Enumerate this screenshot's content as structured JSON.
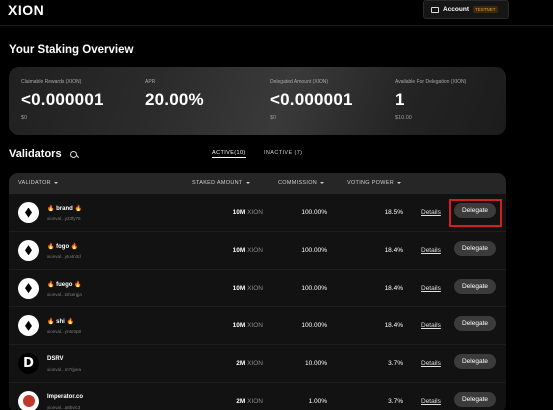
{
  "header": {
    "logo": "XION",
    "account_label": "Account",
    "network_badge": "TESTNET"
  },
  "overview": {
    "title": "Your Staking Overview",
    "stats": [
      {
        "label": "Claimable Rewards (XION)",
        "value": "<0.000001",
        "sub": "$0"
      },
      {
        "label": "APR",
        "value": "20.00%",
        "sub": ""
      },
      {
        "label": "Delegated Amount (XION)",
        "value": "<0.000001",
        "sub": "$0"
      },
      {
        "label": "Available For Delegation (XION)",
        "value": "1",
        "sub": "$10.00"
      }
    ]
  },
  "validators": {
    "title": "Validators",
    "tabs": [
      {
        "label": "ACTIVE(10)",
        "active": true
      },
      {
        "label": "INACTIVE (7)",
        "active": false
      }
    ],
    "columns": {
      "validator": "VALIDATOR",
      "staked": "STAKED AMOUNT",
      "commission": "COMMISSION",
      "power": "VOTING POWER"
    },
    "details_label": "Details",
    "delegate_label": "Delegate",
    "rows": [
      {
        "name": "🔥 brand 🔥",
        "address": "xionval...y23fy75",
        "staked": "10M",
        "unit": "XION",
        "commission": "100.00%",
        "power": "18.5%",
        "avatar": "diamond"
      },
      {
        "name": "🔥 fogo 🔥",
        "address": "xionval...ytu4n3d",
        "staked": "10M",
        "unit": "XION",
        "commission": "100.00%",
        "power": "18.4%",
        "avatar": "diamond"
      },
      {
        "name": "🔥 fuego 🔥",
        "address": "xionval...tsfxergja",
        "staked": "10M",
        "unit": "XION",
        "commission": "100.00%",
        "power": "18.4%",
        "avatar": "diamond"
      },
      {
        "name": "🔥 shi 🔥",
        "address": "xionval...yn6r3p8",
        "staked": "10M",
        "unit": "XION",
        "commission": "100.00%",
        "power": "18.4%",
        "avatar": "diamond"
      },
      {
        "name": "DSRV",
        "address": "xionval...m7rjpea",
        "staked": "2M",
        "unit": "XION",
        "commission": "10.00%",
        "power": "3.7%",
        "avatar": "dsrv"
      },
      {
        "name": "Imperator.co",
        "address": "xionval...a8bvlc3",
        "staked": "2M",
        "unit": "XION",
        "commission": "1.00%",
        "power": "3.7%",
        "avatar": "imperator"
      }
    ]
  }
}
